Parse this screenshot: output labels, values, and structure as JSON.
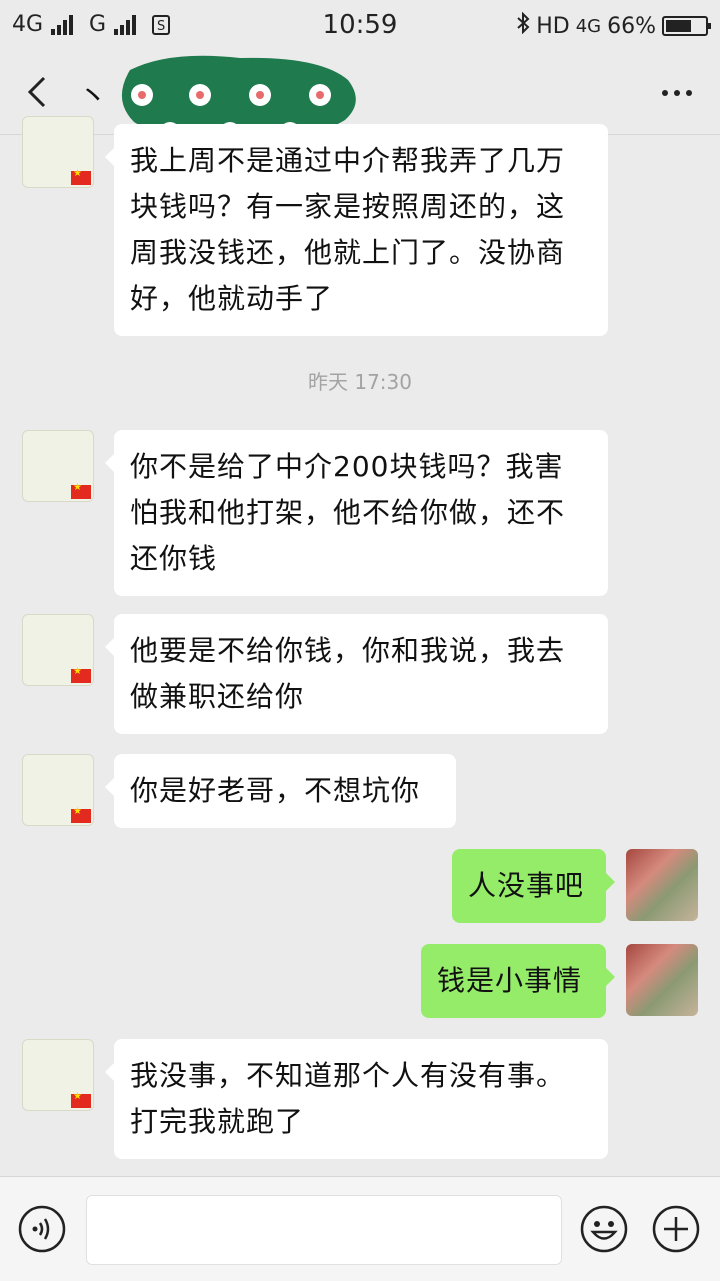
{
  "status_bar": {
    "network1": "4G",
    "network2": "G",
    "time": "10:59",
    "hd": "HD",
    "network3": "4G",
    "battery": "66%",
    "battery_level": 0.66
  },
  "header": {
    "title": "丶",
    "more_icon": "more-icon"
  },
  "messages": [
    {
      "side": "in",
      "text": "我上周不是通过中介帮我弄了几万块钱吗？有一家是按照周还的，这周我没钱还，他就上门了。没协商好，他就动手了"
    },
    {
      "timestamp": "昨天 17:30"
    },
    {
      "side": "in",
      "text": "你不是给了中介200块钱吗？我害怕我和他打架，他不给你做，还不还你钱"
    },
    {
      "side": "in",
      "text": "他要是不给你钱，你和我说，我去做兼职还给你"
    },
    {
      "side": "in",
      "text": "你是好老哥，不想坑你"
    },
    {
      "side": "out",
      "text": "人没事吧"
    },
    {
      "side": "out",
      "text": "钱是小事情"
    },
    {
      "side": "in",
      "text": "我没事，不知道那个人有没有事。打完我就跑了"
    }
  ],
  "input_bar": {
    "placeholder": "",
    "value": ""
  },
  "colors": {
    "background": "#ebebeb",
    "incoming_bubble": "#ffffff",
    "outgoing_bubble": "#95ec69",
    "mask": "#1f7a4d"
  }
}
